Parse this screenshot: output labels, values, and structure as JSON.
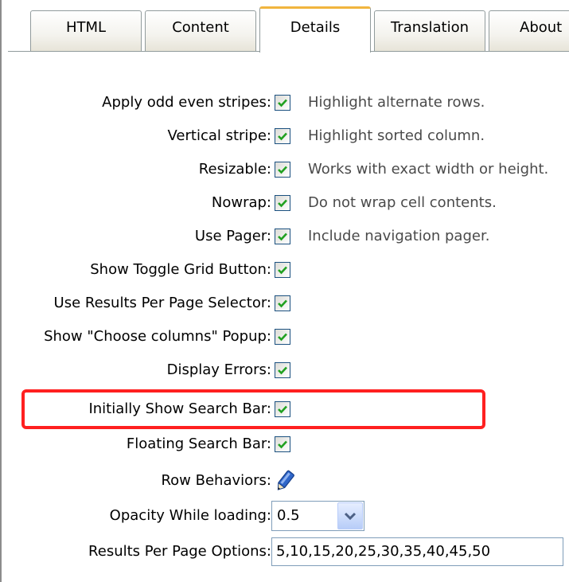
{
  "tabs": [
    {
      "label": "HTML",
      "active": false
    },
    {
      "label": "Content",
      "active": false
    },
    {
      "label": "Details",
      "active": true
    },
    {
      "label": "Translation",
      "active": false
    },
    {
      "label": "About",
      "active": false
    }
  ],
  "options": [
    {
      "label": "Apply odd even stripes:",
      "checked": true,
      "description": "Highlight alternate rows."
    },
    {
      "label": "Vertical stripe:",
      "checked": true,
      "description": "Highlight sorted column."
    },
    {
      "label": "Resizable:",
      "checked": true,
      "description": "Works with exact width or height."
    },
    {
      "label": "Nowrap:",
      "checked": true,
      "description": "Do not wrap cell contents."
    },
    {
      "label": "Use Pager:",
      "checked": true,
      "description": "Include navigation pager."
    },
    {
      "label": "Show Toggle Grid Button:",
      "checked": true,
      "description": ""
    },
    {
      "label": "Use Results Per Page Selector:",
      "checked": true,
      "description": ""
    },
    {
      "label": "Show \"Choose columns\" Popup:",
      "checked": true,
      "description": ""
    },
    {
      "label": "Display Errors:",
      "checked": true,
      "description": ""
    },
    {
      "label": "Initially Show Search Bar:",
      "checked": true,
      "description": "",
      "highlighted": true
    },
    {
      "label": "Floating Search Bar:",
      "checked": true,
      "description": ""
    }
  ],
  "row_behaviors": {
    "label": "Row Behaviors:",
    "icon": "edit-pencil-icon"
  },
  "opacity": {
    "label": "Opacity While loading:",
    "value": "0.5"
  },
  "results_per_page": {
    "label": "Results Per Page Options:",
    "value": "5,10,15,20,25,30,35,40,45,50"
  },
  "colors": {
    "highlight_border": "#ff2020",
    "active_tab_accent": "#f1b53e",
    "check_green": "#21a121"
  }
}
